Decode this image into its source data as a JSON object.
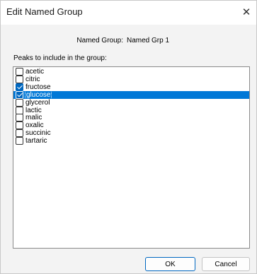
{
  "dialog": {
    "title": "Edit Named Group",
    "close_icon": "close-icon"
  },
  "named_group": {
    "label": "Named Group:",
    "value": "Named Grp 1"
  },
  "peaks_label": "Peaks to include in the group:",
  "peaks": [
    {
      "label": "acetic",
      "checked": false,
      "selected": false
    },
    {
      "label": "citric",
      "checked": false,
      "selected": false
    },
    {
      "label": "fructose",
      "checked": true,
      "selected": false
    },
    {
      "label": "glucose",
      "checked": true,
      "selected": true
    },
    {
      "label": "glycerol",
      "checked": false,
      "selected": false
    },
    {
      "label": "lactic",
      "checked": false,
      "selected": false
    },
    {
      "label": "malic",
      "checked": false,
      "selected": false
    },
    {
      "label": "oxalic",
      "checked": false,
      "selected": false
    },
    {
      "label": "succinic",
      "checked": false,
      "selected": false
    },
    {
      "label": "tartaric",
      "checked": false,
      "selected": false
    }
  ],
  "buttons": {
    "ok": "OK",
    "cancel": "Cancel"
  },
  "colors": {
    "selection": "#0078d7",
    "accent": "#0067c0"
  }
}
